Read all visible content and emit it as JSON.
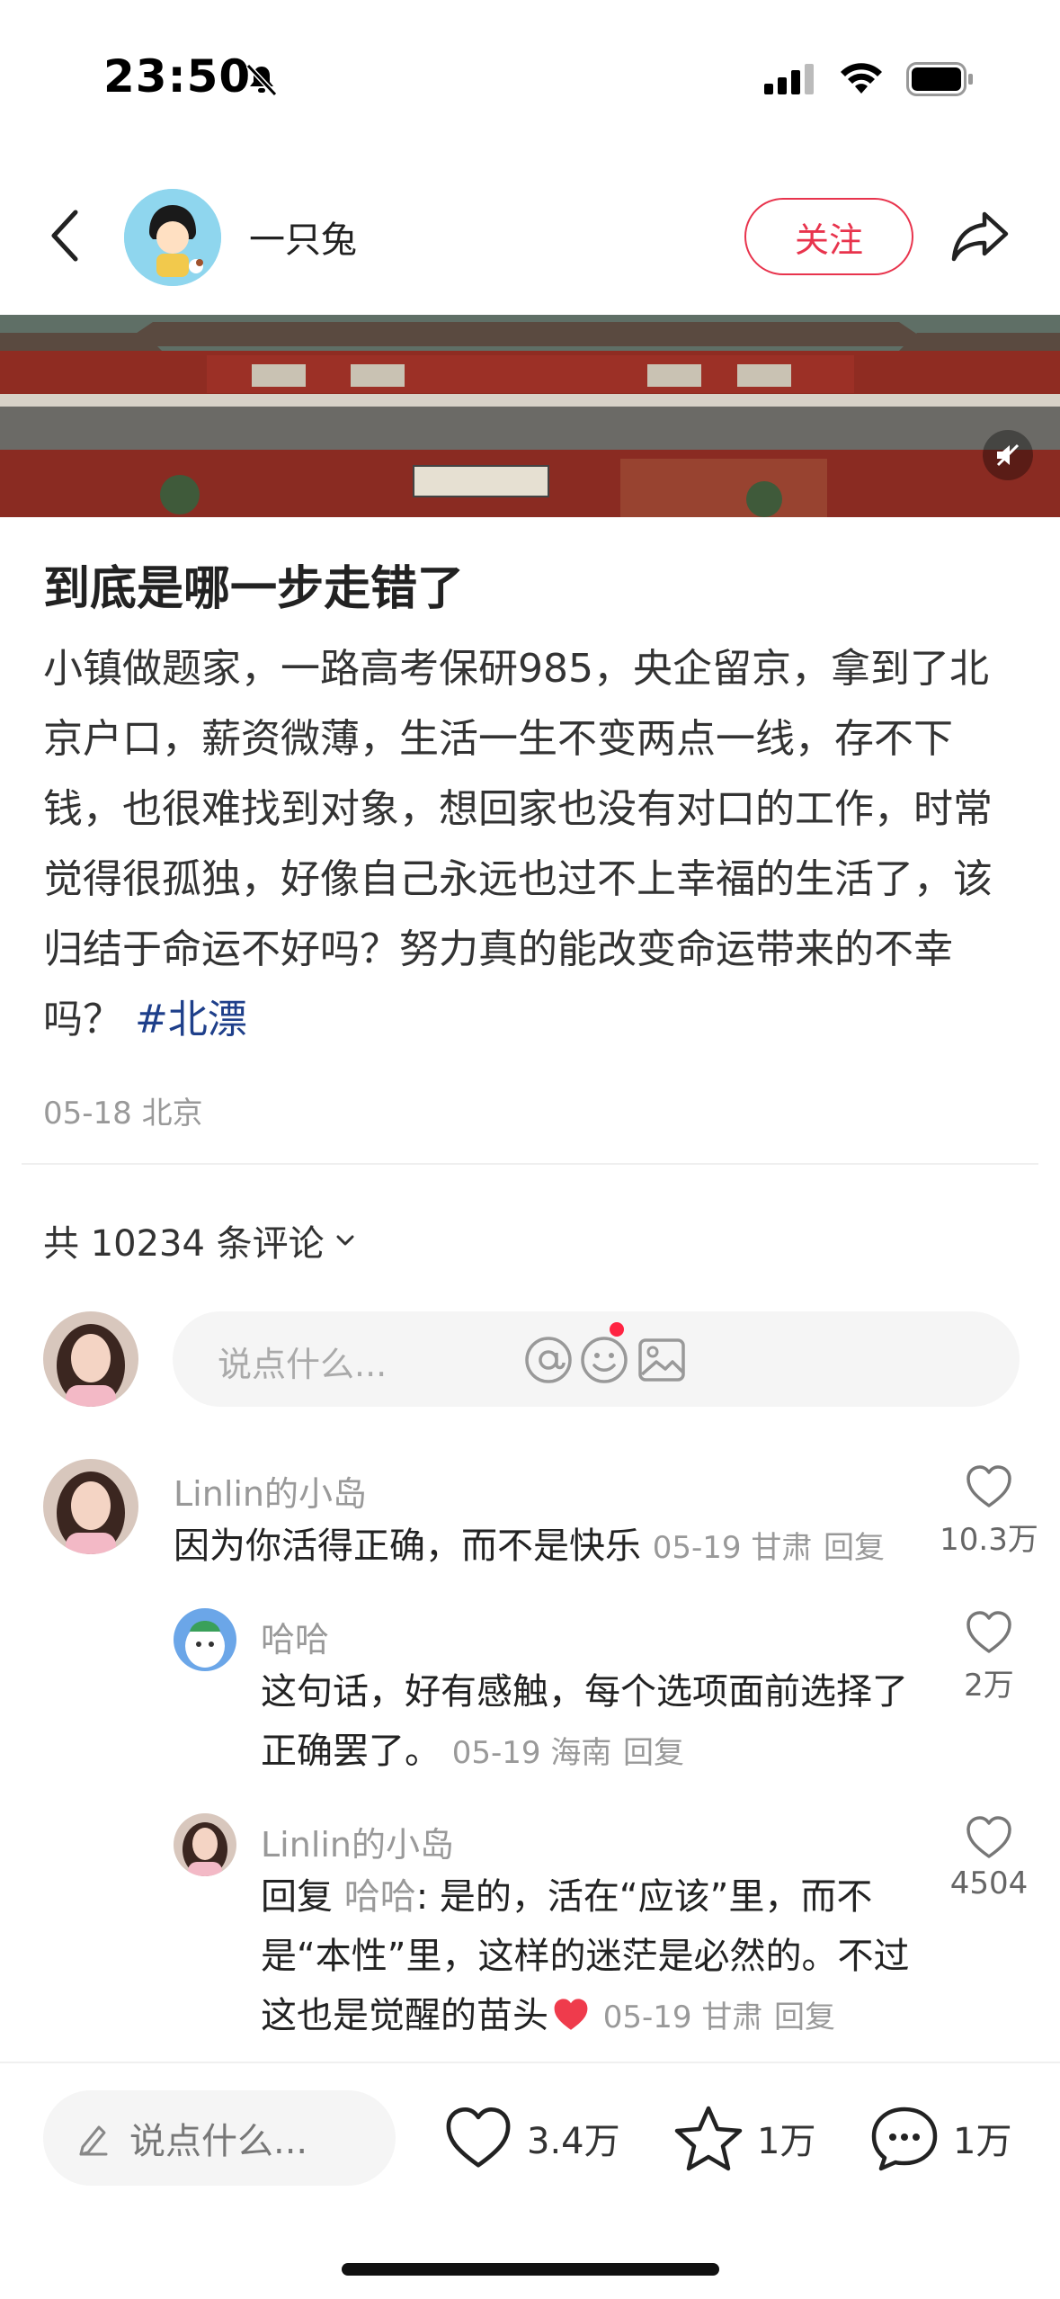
{
  "status_bar": {
    "time": "23:50",
    "icons": [
      "bell-muted-icon",
      "signal-icon",
      "wifi-icon",
      "battery-icon"
    ]
  },
  "nav": {
    "author_name": "一只兔",
    "follow_label": "关注",
    "icons": [
      "back-icon",
      "share-icon"
    ]
  },
  "post": {
    "title": "到底是哪一步走错了",
    "body": "小镇做题家，一路高考保研985，央企留京，拿到了北京户口，薪资微薄，生活一生不变两点一线，存不下钱，也很难找到对象，想回家也没有对口的工作，时常觉得很孤独，好像自己永远也过不上幸福的生活了，该归结于命运不好吗？努力真的能改变命运带来的不幸吗？",
    "hashtag": "#北漂",
    "meta": "05-18 北京"
  },
  "comments_header": {
    "count_label": "共 10234 条评论"
  },
  "comment_input": {
    "placeholder": "说点什么..."
  },
  "comments": [
    {
      "name": "Linlin的小岛",
      "text": "因为你活得正确，而不是快乐",
      "meta": "05-19 甘肃",
      "reply": "回复",
      "likes": "10.3万"
    },
    {
      "name": "哈哈",
      "text": "这句话，好有感触，每个选项面前选择了正确罢了。",
      "meta": "05-19 海南",
      "reply": "回复",
      "likes": "2万"
    },
    {
      "name": "Linlin的小岛",
      "reply_prefix": "回复",
      "reply_to": "哈哈",
      "text": ": 是的，活在“应该”里，而不是“本性”里，这样的迷茫是必然的。不过这也是觉醒的苗头",
      "meta": "05-19 甘肃",
      "reply": "回复",
      "likes": "4504"
    }
  ],
  "bottom_bar": {
    "placeholder": "说点什么...",
    "likes": "3.4万",
    "collects": "1万",
    "comments": "1万"
  },
  "colors": {
    "accent": "#e8344d",
    "hashtag": "#1e3f8a",
    "meta": "#999999"
  }
}
